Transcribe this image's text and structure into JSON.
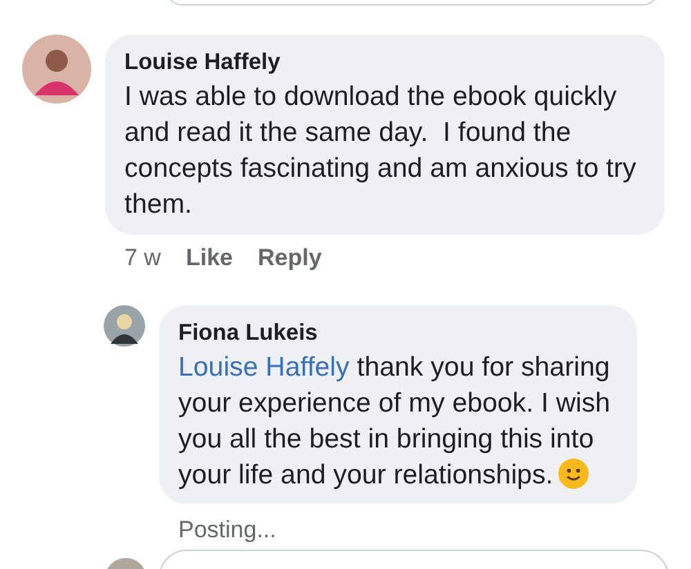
{
  "comments": [
    {
      "author": "Louise Haffely",
      "text": "I was able to download the ebook quickly and read it the same day.  I found the concepts fascinating and am anxious to try them.",
      "time": "7 w",
      "actions": [
        "Like",
        "Reply"
      ]
    }
  ],
  "reply": {
    "author": "Fiona Lukeis",
    "mention": "Louise Haffely",
    "text": "thank you for sharing your experience of my ebook. I wish you all the best in bringing this into your life and your relationships.",
    "status": "Posting..."
  }
}
